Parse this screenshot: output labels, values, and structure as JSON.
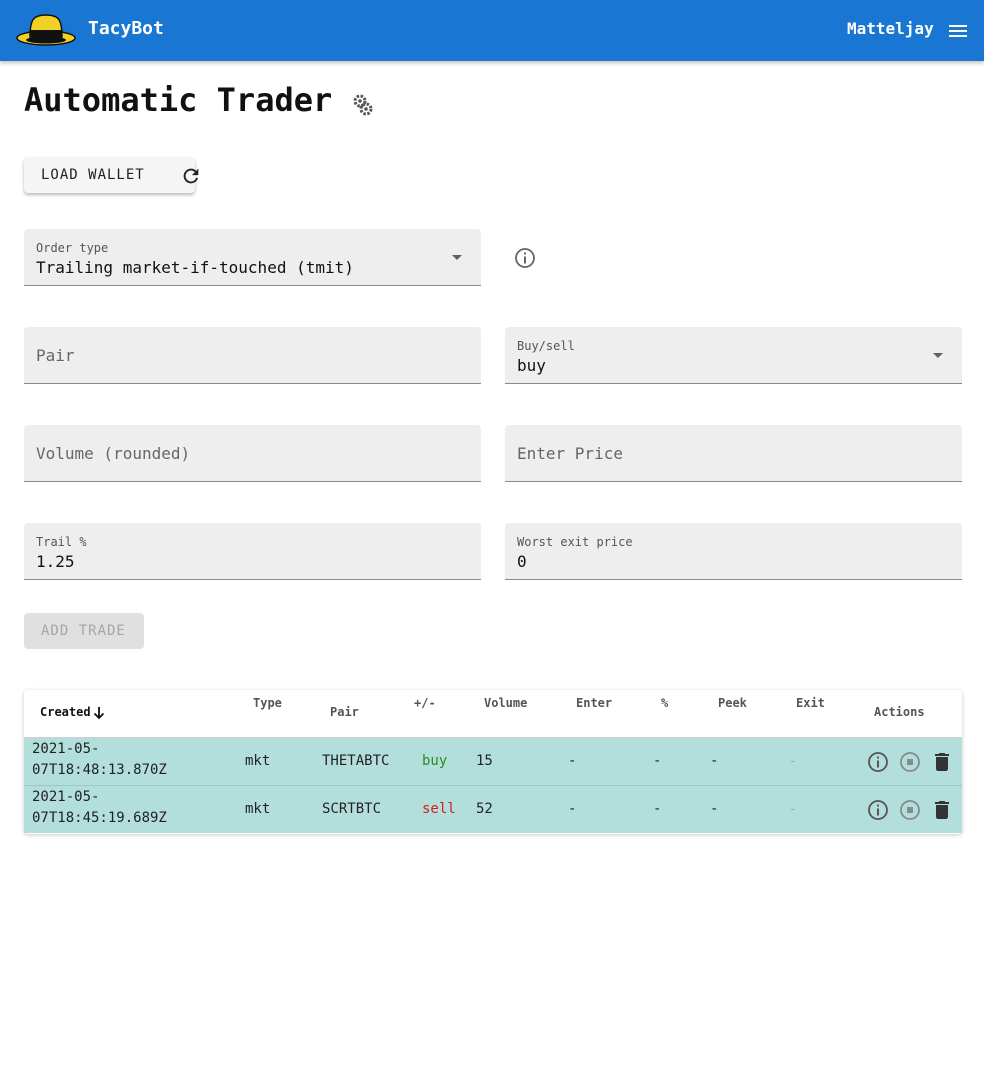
{
  "app": {
    "title": "TacyBot",
    "user": "Matteljay"
  },
  "page": {
    "title": "Automatic Trader",
    "load_wallet": "LOAD WALLET",
    "add_trade": "ADD TRADE"
  },
  "form": {
    "order_type": {
      "label": "Order type",
      "value": "Trailing market-if-touched (tmit)"
    },
    "pair": {
      "placeholder": "Pair"
    },
    "buy_sell": {
      "label": "Buy/sell",
      "value": "buy"
    },
    "volume": {
      "placeholder": "Volume (rounded)"
    },
    "enter_price": {
      "placeholder": "Enter Price"
    },
    "trail": {
      "label": "Trail %",
      "value": "1.25"
    },
    "worst_exit": {
      "label": "Worst exit price",
      "value": "0"
    }
  },
  "table": {
    "headers": {
      "created": "Created",
      "type": "Type",
      "pair": "Pair",
      "side": "+/-",
      "volume": "Volume",
      "enter": "Enter",
      "pct": "%",
      "peek": "Peek",
      "exit": "Exit",
      "actions": "Actions"
    },
    "rows": [
      {
        "created_1": "2021-05-",
        "created_2": "07T18:48:13.870Z",
        "type": "mkt",
        "pair": "THETABTC",
        "side": "buy",
        "volume": "15",
        "enter": "-",
        "pct": "-",
        "peek": "-",
        "exit": "-"
      },
      {
        "created_1": "2021-05-",
        "created_2": "07T18:45:19.689Z",
        "type": "mkt",
        "pair": "SCRTBTC",
        "side": "sell",
        "volume": "52",
        "enter": "-",
        "pct": "-",
        "peek": "-",
        "exit": "-"
      }
    ]
  },
  "colors": {
    "appbar": "#1976d2",
    "row_bg": "#b2dfdb",
    "buy": "#2e8b1f",
    "sell": "#d01f1f"
  }
}
